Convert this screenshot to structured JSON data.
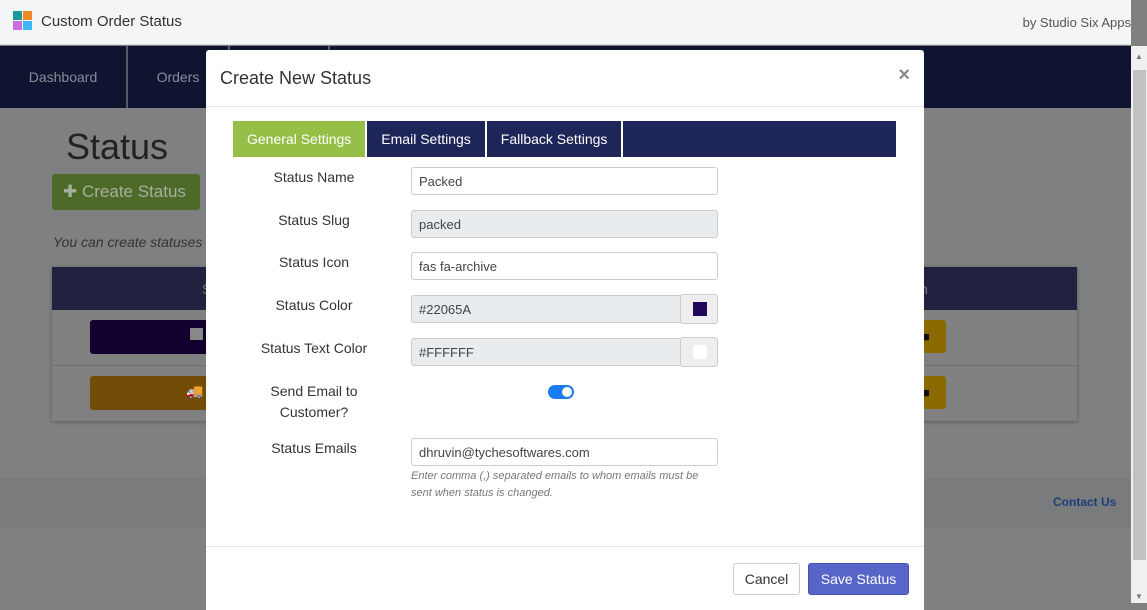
{
  "header": {
    "app_title": "Custom Order Status",
    "byline": "by Studio Six Apps"
  },
  "nav": {
    "items": [
      "Dashboard",
      "Orders"
    ]
  },
  "page": {
    "title": "Status",
    "create_button": "Create Status",
    "hint": "You can create statuses",
    "table_header_left": "S",
    "table_header_right": "n",
    "contact": "Contact Us"
  },
  "modal": {
    "title": "Create New Status",
    "close": "×",
    "tabs": [
      {
        "label": "General Settings",
        "active": true
      },
      {
        "label": "Email Settings"
      },
      {
        "label": "Fallback Settings"
      }
    ],
    "fields": {
      "name": {
        "label": "Status Name",
        "value": "Packed"
      },
      "slug": {
        "label": "Status Slug",
        "value": "packed"
      },
      "icon": {
        "label": "Status Icon",
        "value": "fas fa-archive"
      },
      "color": {
        "label": "Status Color",
        "value": "#22065A"
      },
      "text_color": {
        "label": "Status Text Color",
        "value": "#FFFFFF"
      },
      "send_email": {
        "label_line1": "Send Email to",
        "label_line2": "Customer?",
        "enabled": true
      },
      "emails": {
        "label": "Status Emails",
        "value": "dhruvin@tychesoftwares.com",
        "help": "Enter comma (,) separated emails to whom emails must be sent when status is changed."
      }
    },
    "cancel": "Cancel",
    "save": "Save Status"
  },
  "colors": {
    "accent_tab": "#96bf48",
    "tabs_bg": "#1d2559",
    "nav": "#0f1431",
    "save": "#5865c8",
    "toggle": "#1a7cf2"
  }
}
